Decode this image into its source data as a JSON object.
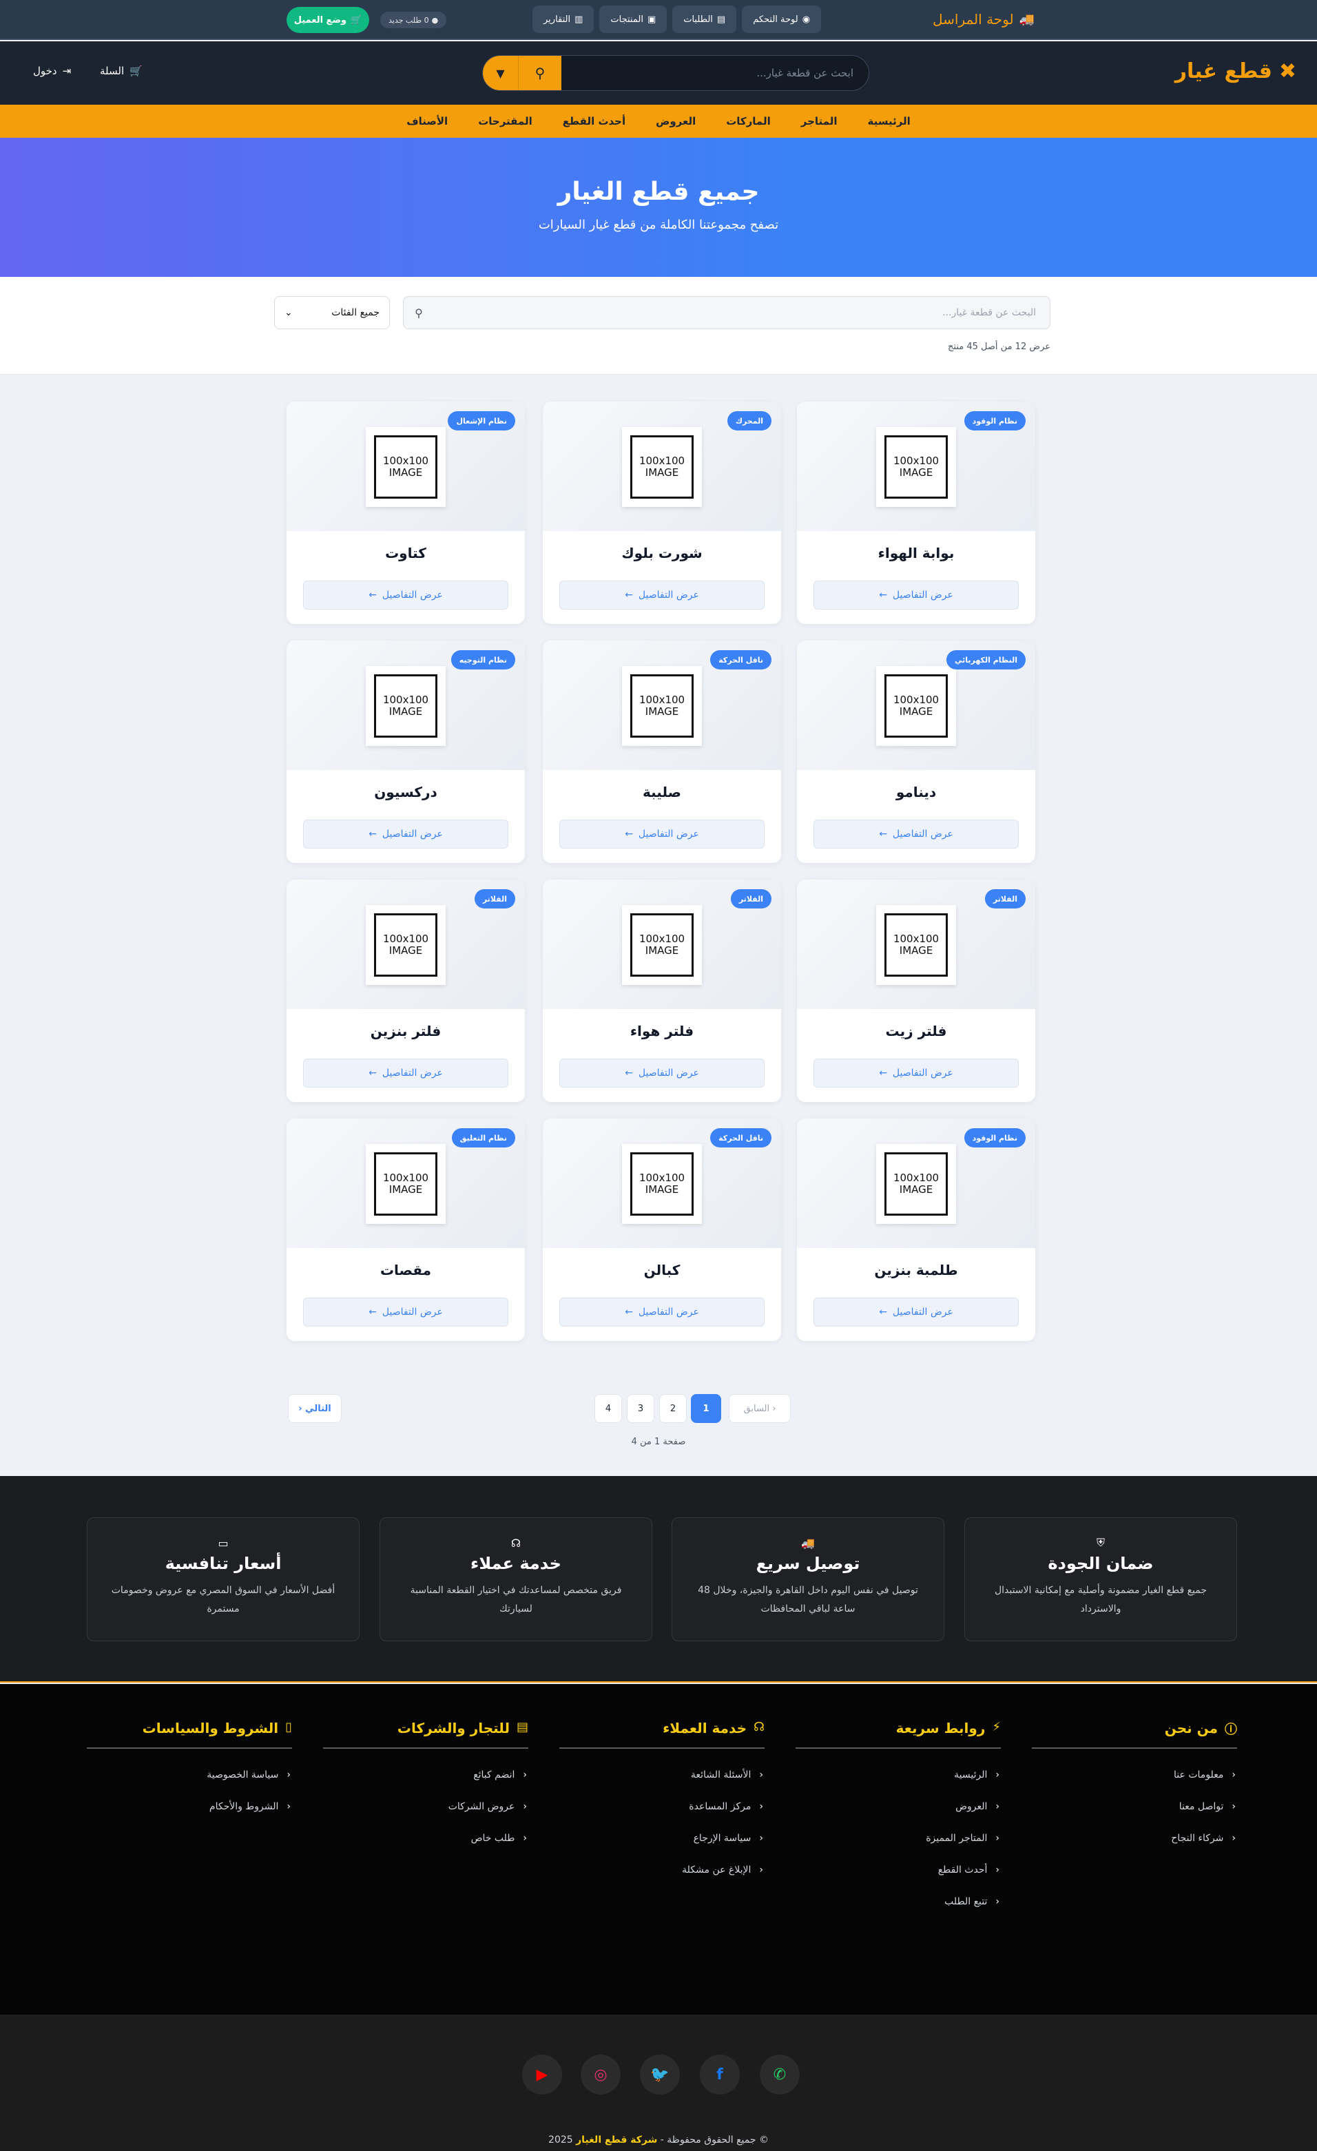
{
  "admin_bar": {
    "brand": "لوحة المراسل",
    "tabs": [
      {
        "label": "لوحة التحكم",
        "icon": "dashboard-icon"
      },
      {
        "label": "الطلبات",
        "icon": "clipboard-icon"
      },
      {
        "label": "المنتجات",
        "icon": "box-icon"
      },
      {
        "label": "التقارير",
        "icon": "chart-icon"
      }
    ],
    "notification": "0 طلب جديد",
    "mode_button": "وضع العميل"
  },
  "header": {
    "logo": "قطع غيار",
    "search_placeholder": "ابحث عن قطعة غيار...",
    "cart_label": "السلة",
    "login_label": "دخول"
  },
  "nav": [
    "الرئيسية",
    "المتاجر",
    "الماركات",
    "العروض",
    "أحدث القطع",
    "المقترحات",
    "الأصناف"
  ],
  "hero": {
    "title": "جميع قطع الغيار",
    "subtitle": "تصفح مجموعتنا الكاملة من قطع غيار السيارات"
  },
  "filters": {
    "search_placeholder": "البحث عن قطعة غيار...",
    "category_selected": "جميع الفئات",
    "result_count": "عرض 12 من أصل 45 منتج"
  },
  "products": [
    {
      "name": "بوابة الهواء",
      "badge": "نظام الوقود",
      "button": "عرض التفاصيل"
    },
    {
      "name": "شورت بلوك",
      "badge": "المحرك",
      "button": "عرض التفاصيل"
    },
    {
      "name": "كتاوت",
      "badge": "نظام الإشعال",
      "button": "عرض التفاصيل"
    },
    {
      "name": "دينامو",
      "badge": "النظام الكهربائي",
      "button": "عرض التفاصيل"
    },
    {
      "name": "صليبة",
      "badge": "ناقل الحركة",
      "button": "عرض التفاصيل"
    },
    {
      "name": "دركسيون",
      "badge": "نظام التوجيه",
      "button": "عرض التفاصيل"
    },
    {
      "name": "فلتر زيت",
      "badge": "الفلاتر",
      "button": "عرض التفاصيل"
    },
    {
      "name": "فلتر هواء",
      "badge": "الفلاتر",
      "button": "عرض التفاصيل"
    },
    {
      "name": "فلتر بنزين",
      "badge": "الفلاتر",
      "button": "عرض التفاصيل"
    },
    {
      "name": "طلمبة بنزين",
      "badge": "نظام الوقود",
      "button": "عرض التفاصيل"
    },
    {
      "name": "كبالن",
      "badge": "ناقل الحركة",
      "button": "عرض التفاصيل"
    },
    {
      "name": "مقصات",
      "badge": "نظام التعليق",
      "button": "عرض التفاصيل"
    }
  ],
  "placeholder_image": {
    "line1": "100x100",
    "line2": "IMAGE"
  },
  "pagination": {
    "prev": "السابق",
    "pages": [
      "1",
      "2",
      "3",
      "4"
    ],
    "active": "1",
    "next": "التالي",
    "info": "صفحة 1 من 4"
  },
  "features": [
    {
      "icon": "shield-icon",
      "title": "ضمان الجودة",
      "desc": "جميع قطع الغيار مضمونة وأصلية مع إمكانية الاستبدال والاسترداد"
    },
    {
      "icon": "truck-icon",
      "title": "توصيل سريع",
      "desc": "توصيل في نفس اليوم داخل القاهرة والجيزة، وخلال 48 ساعة لباقي المحافظات"
    },
    {
      "icon": "headset-icon",
      "title": "خدمة عملاء",
      "desc": "فريق متخصص لمساعدتك في اختيار القطعة المناسبة لسيارتك"
    },
    {
      "icon": "money-icon",
      "title": "أسعار تنافسية",
      "desc": "أفضل الأسعار في السوق المصري مع عروض وخصومات مستمرة"
    }
  ],
  "footer": {
    "columns": [
      {
        "title": "من نحن",
        "icon": "info-icon",
        "links": [
          "معلومات عنا",
          "تواصل معنا",
          "شركاء النجاح"
        ]
      },
      {
        "title": "روابط سريعة",
        "icon": "bolt-icon",
        "links": [
          "الرئيسية",
          "العروض",
          "المتاجر المميزة",
          "أحدث القطع",
          "تتبع الطلب"
        ]
      },
      {
        "title": "خدمة العملاء",
        "icon": "headset-icon",
        "links": [
          "الأسئلة الشائعة",
          "مركز المساعدة",
          "سياسة الإرجاع",
          "الإبلاغ عن مشكلة"
        ]
      },
      {
        "title": "للتجار والشركات",
        "icon": "store-icon",
        "links": [
          "انضم كبائع",
          "عروض الشركات",
          "طلب خاص"
        ]
      },
      {
        "title": "الشروط والسياسات",
        "icon": "document-icon",
        "links": [
          "سياسة الخصوصية",
          "الشروط والأحكام"
        ]
      }
    ],
    "social": [
      {
        "name": "whatsapp-icon",
        "color": "#25d366"
      },
      {
        "name": "facebook-icon",
        "color": "#1877f2"
      },
      {
        "name": "twitter-icon",
        "color": "#1da1f2"
      },
      {
        "name": "instagram-icon",
        "color": "#e1306c"
      },
      {
        "name": "youtube-icon",
        "color": "#ff0000"
      }
    ],
    "copyright_prefix": "© جميع الحقوق محفوظة - ",
    "copyright_brand": "شركة قطع الغيار",
    "copyright_year": " 2025"
  },
  "colors": {
    "accent": "#f59e0b",
    "primary": "#3b82f6",
    "success": "#10b981",
    "footer_heading": "#facc15"
  }
}
